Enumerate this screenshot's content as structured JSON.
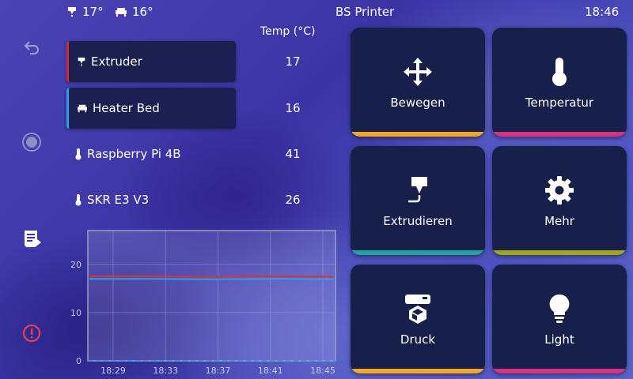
{
  "status_bar": {
    "extruder_temp": "17°",
    "bed_temp": "16°",
    "printer_name": "BS Printer",
    "time": "18:46"
  },
  "temp_header": "Temp (°C)",
  "devices": [
    {
      "name": "Extruder",
      "value": "17",
      "icon": "extruder-icon"
    },
    {
      "name": "Heater Bed",
      "value": "16",
      "icon": "bed-icon"
    },
    {
      "name": "Raspberry Pi 4B",
      "value": "41",
      "icon": "thermometer-icon"
    },
    {
      "name": "SKR E3 V3",
      "value": "26",
      "icon": "thermometer-icon"
    }
  ],
  "menu": [
    {
      "label": "Bewegen",
      "icon": "move-icon",
      "color": "#f5a623"
    },
    {
      "label": "Temperatur",
      "icon": "thermometer-icon",
      "color": "#d63384"
    },
    {
      "label": "Extrudieren",
      "icon": "extrude-icon",
      "color": "#1fa2a0"
    },
    {
      "label": "Mehr",
      "icon": "gear-icon",
      "color": "#a3a61a"
    },
    {
      "label": "Druck",
      "icon": "print-icon",
      "color": "#f5a623"
    },
    {
      "label": "Light",
      "icon": "lightbulb-icon",
      "color": "#d63384"
    }
  ],
  "chart_data": {
    "type": "line",
    "x": [
      "18:29",
      "18:33",
      "18:37",
      "18:41",
      "18:45"
    ],
    "y_ticks": [
      0,
      10,
      20
    ],
    "ylim": [
      0,
      27
    ],
    "series": [
      {
        "values": [
          17.5,
          17.5,
          17.4,
          17.5,
          17.4
        ],
        "color": "#e03030"
      },
      {
        "values": [
          17.0,
          17.0,
          16.9,
          17.0,
          16.9
        ],
        "color": "#2aa0e8"
      }
    ],
    "grid": true
  }
}
